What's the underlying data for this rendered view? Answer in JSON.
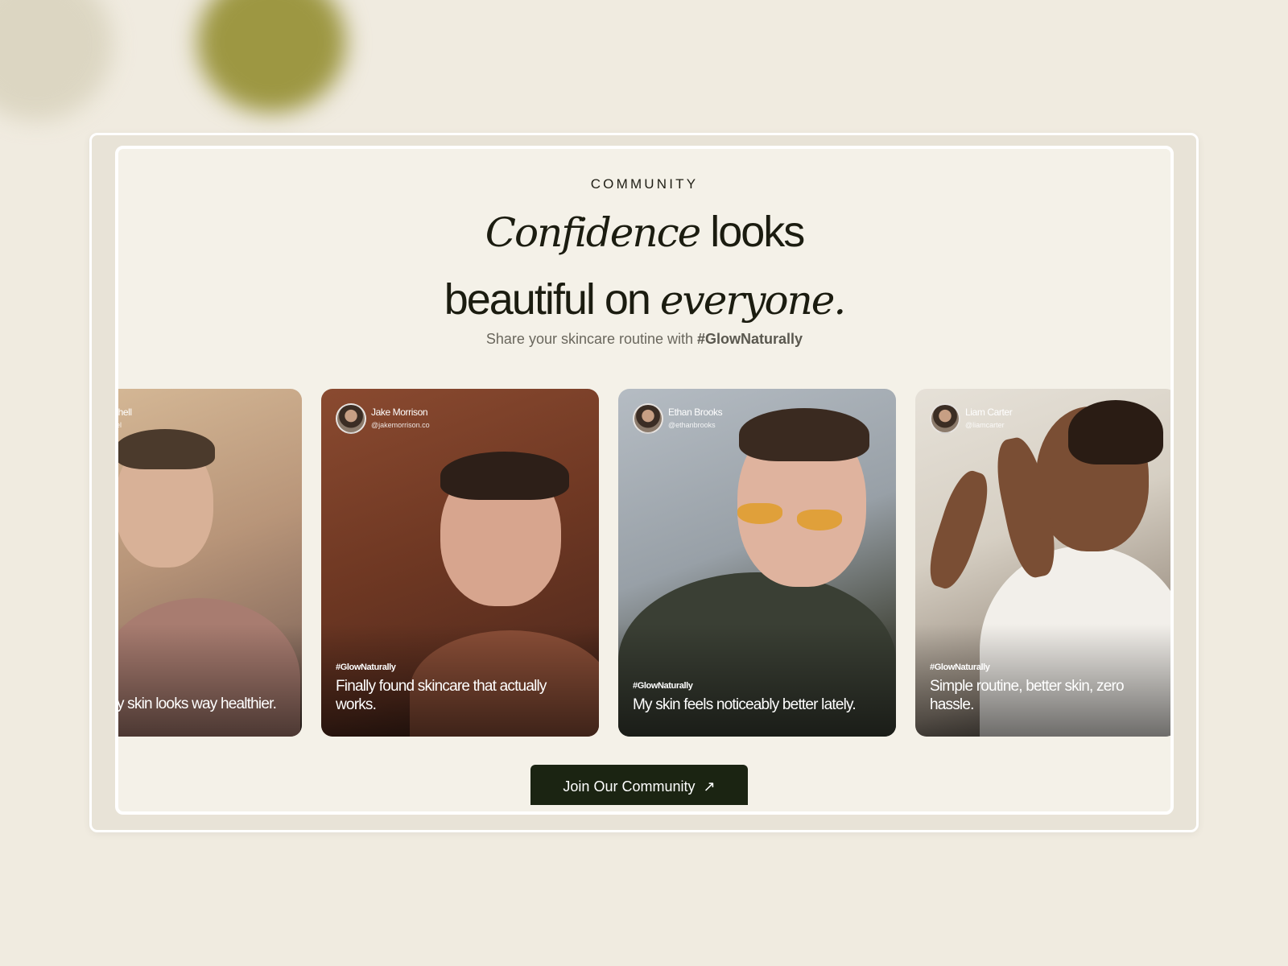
{
  "section": {
    "eyebrow": "COMMUNITY",
    "headline": {
      "line1_serif": "Confidence",
      "line1_sans": " looks",
      "line2_sans": "beautiful on ",
      "line2_serif": "everyone."
    },
    "subtitle_prefix": "Share your skincare routine with ",
    "subtitle_hashtag": "#GlowNaturally"
  },
  "cards": [
    {
      "name": "…hell",
      "handle": "…el",
      "hashtag": "",
      "caption": "y skin looks way healthier."
    },
    {
      "name": "Jake Morrison",
      "handle": "@jakemorrison.co",
      "hashtag": "#GlowNaturally",
      "caption": "Finally found skincare that actually works."
    },
    {
      "name": "Ethan Brooks",
      "handle": "@ethanbrooks",
      "hashtag": "#GlowNaturally",
      "caption": "My skin feels noticeably better lately."
    },
    {
      "name": "Liam Carter",
      "handle": "@liamcarter",
      "hashtag": "#GlowNaturally",
      "caption": "Simple routine, better skin, zero hassle."
    }
  ],
  "cta": {
    "label": "Join Our Community",
    "icon": "arrow-up-right-icon"
  },
  "colors": {
    "page_bg": "#f0ebe0",
    "panel_bg": "#f4f1e8",
    "headline": "#1b1c10",
    "cta_bg": "#1b2412",
    "accent_blob": "#9d9742"
  }
}
